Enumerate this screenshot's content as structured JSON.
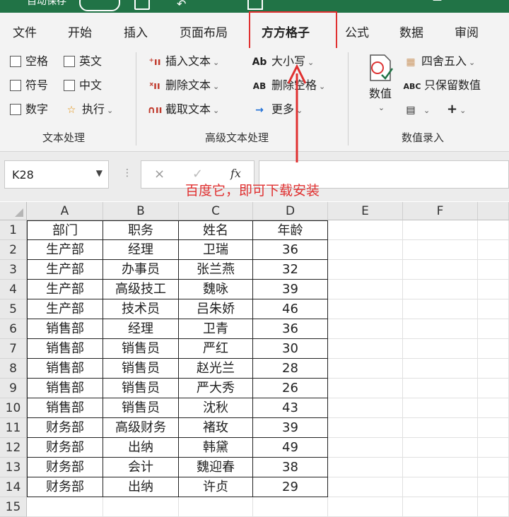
{
  "titlebar": {
    "autosave": "自动保存",
    "extra": "—"
  },
  "tabs": [
    "文件",
    "开始",
    "插入",
    "页面布局",
    "方方格子",
    "公式",
    "数据",
    "审阅"
  ],
  "active_tab": "方方格子",
  "ribbon": {
    "text_group": {
      "label": "文本处理",
      "checkboxes": [
        "空格",
        "英文",
        "符号",
        "中文",
        "数字"
      ],
      "execute": "执行"
    },
    "advanced_group": {
      "label": "高级文本处理",
      "insert_text": "插入文本",
      "delete_text": "删除文本",
      "extract_text": "截取文本",
      "case": "大小写",
      "delete_space": "删除空格",
      "more": "更多",
      "case_icon": "Ab",
      "delete_space_icon": "AB"
    },
    "number_group": {
      "label": "数值录入",
      "value_button": "数值",
      "round": "四舍五入",
      "keep_values": "只保留数值",
      "keep_values_icon": "ABC",
      "plus": "+"
    }
  },
  "formula_bar": {
    "name_box": "K28",
    "cancel": "×",
    "confirm": "✓",
    "fx": "fx",
    "value": ""
  },
  "annotation": "百度它，即可下载安装",
  "sheet": {
    "columns": [
      "A",
      "B",
      "C",
      "D",
      "E",
      "F"
    ],
    "row_numbers": [
      "1",
      "2",
      "3",
      "4",
      "5",
      "6",
      "7",
      "8",
      "9",
      "10",
      "11",
      "12",
      "13",
      "14",
      "15"
    ],
    "rows": [
      [
        "部门",
        "职务",
        "姓名",
        "年龄"
      ],
      [
        "生产部",
        "经理",
        "卫瑞",
        "36"
      ],
      [
        "生产部",
        "办事员",
        "张兰燕",
        "32"
      ],
      [
        "生产部",
        "高级技工",
        "魏咏",
        "39"
      ],
      [
        "生产部",
        "技术员",
        "吕朱娇",
        "46"
      ],
      [
        "销售部",
        "经理",
        "卫青",
        "36"
      ],
      [
        "销售部",
        "销售员",
        "严红",
        "30"
      ],
      [
        "销售部",
        "销售员",
        "赵光兰",
        "28"
      ],
      [
        "销售部",
        "销售员",
        "严大秀",
        "26"
      ],
      [
        "销售部",
        "销售员",
        "沈秋",
        "43"
      ],
      [
        "财务部",
        "高级财务",
        "褚玫",
        "39"
      ],
      [
        "财务部",
        "出纳",
        "韩黛",
        "49"
      ],
      [
        "财务部",
        "会计",
        "魏迎春",
        "38"
      ],
      [
        "财务部",
        "出纳",
        "许贞",
        "29"
      ]
    ]
  },
  "colors": {
    "accent": "#217346",
    "highlight": "#e03030"
  }
}
